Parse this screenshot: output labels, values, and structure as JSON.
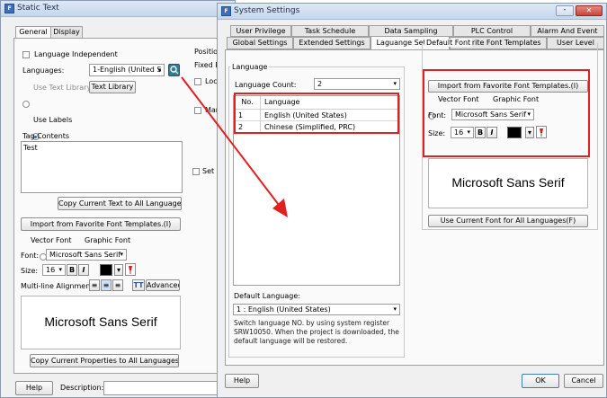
{
  "static_text": {
    "title": "Static Text",
    "tabs": [
      "General",
      "Display"
    ],
    "language_independent": "Language Independent",
    "languages_label": "Languages:",
    "languages_value": "1-English (United S",
    "use_text_library": "Use Text Library",
    "text_library_button": "Text Library",
    "position_label": "Positio",
    "fixed_label": "Fixed P",
    "lock_label": "Lock",
    "marg_label": "Marc",
    "set_label": "Set la",
    "use_labels": "Use Labels",
    "tag_contents_label": "Tag Contents",
    "tag_contents_value": "Test",
    "copy_text_button": "Copy Current Text to All Languages",
    "import_font_button": "Import from Favorite Font Templates.(I)",
    "vector_font": "Vector Font",
    "graphic_font": "Graphic Font",
    "font_label": "Font:",
    "font_value": "Microsoft Sans Serif",
    "size_label": "Size:",
    "size_value": "16",
    "bold": "B",
    "italic": "I",
    "alignment_label": "Multi-line Alignment:",
    "tt_glyph": "TT",
    "advanced_button": "Advanced",
    "preview_text": "Microsoft Sans Serif",
    "copy_props_button": "Copy Current Properties to All Languages",
    "help_button": "Help",
    "description_label": "Description:"
  },
  "system_settings": {
    "title": "System Settings",
    "tabs_row1": [
      "User Privilege",
      "Task Schedule",
      "Data Sampling",
      "PLC Control",
      "Alarm And Event"
    ],
    "tabs_row2": [
      "Global Settings",
      "Extended Settings",
      "Laguange Settings",
      "Favorite Font Templates",
      "User Level"
    ],
    "language_group": "Language",
    "language_count_label": "Language Count:",
    "language_count_value": "2",
    "table_headers": [
      "No.",
      "Language"
    ],
    "table_rows": [
      [
        "1",
        "English (United States)"
      ],
      [
        "2",
        "Chinese (Simplified, PRC)"
      ]
    ],
    "default_language_label": "Default Language:",
    "default_language_value": "1 : English (United States)",
    "note": "Switch language NO. by using system register SRW10050. When the project is downloaded, the default language will be restored.",
    "default_font_group": "Default Font",
    "import_font_button": "Import from Favorite Font Templates.(I)",
    "vector_font": "Vector Font",
    "graphic_font": "Graphic Font",
    "font_label": "Font:",
    "font_value": "Microsoft Sans Serif",
    "size_label": "Size:",
    "size_value": "16",
    "bold": "B",
    "italic": "I",
    "preview_text": "Microsoft Sans Serif",
    "use_current_font_button": "Use Current Font for All Languages(F)",
    "help_button": "Help",
    "ok_button": "OK",
    "cancel_button": "Cancel"
  },
  "colors": {
    "highlight_red": "#e22020",
    "close_button": "#c9443a",
    "title_blue": "#c5d6ec"
  }
}
